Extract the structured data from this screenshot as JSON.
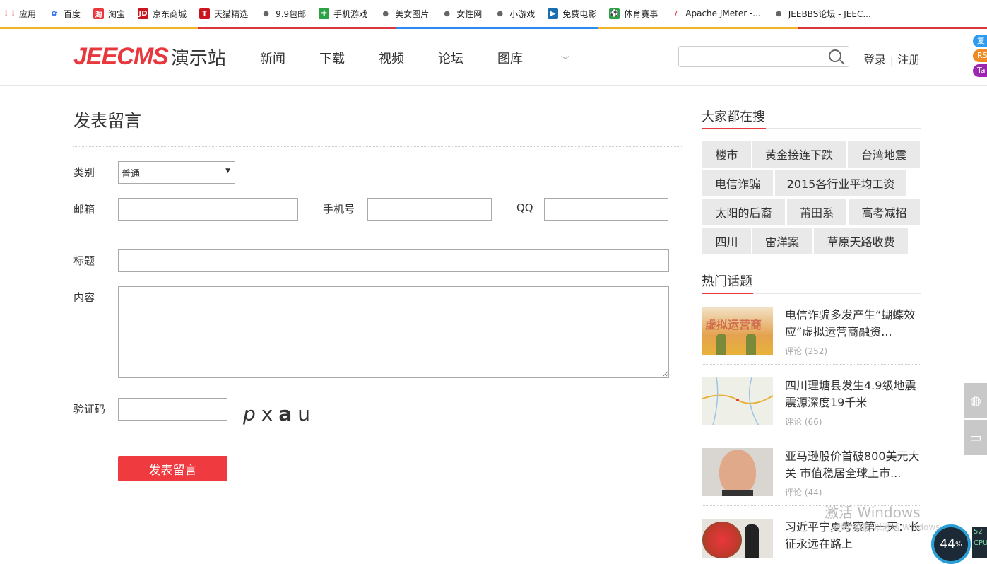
{
  "bookmarks": [
    {
      "label": "应用",
      "icon": "apps-grid-icon",
      "color": "#e8383d"
    },
    {
      "label": "百度",
      "icon": "baidu-paw-icon",
      "color": "#2d6df0"
    },
    {
      "label": "淘宝",
      "icon": "taobao-icon",
      "color": "#e8383d"
    },
    {
      "label": "京东商城",
      "icon": "jd-icon",
      "color": "#c9151e"
    },
    {
      "label": "天猫精选",
      "icon": "tmall-icon",
      "color": "#c9151e"
    },
    {
      "label": "9.9包邮",
      "icon": "globe-icon",
      "color": "#666666"
    },
    {
      "label": "手机游戏",
      "icon": "game-icon",
      "color": "#2ba245"
    },
    {
      "label": "美女图片",
      "icon": "globe-icon",
      "color": "#666666"
    },
    {
      "label": "女性网",
      "icon": "globe-icon",
      "color": "#666666"
    },
    {
      "label": "小游戏",
      "icon": "globe-icon",
      "color": "#666666"
    },
    {
      "label": "免费电影",
      "icon": "film-icon",
      "color": "#1a6fb0"
    },
    {
      "label": "体育赛事",
      "icon": "sports-icon",
      "color": "#2ba245"
    },
    {
      "label": "Apache JMeter -...",
      "icon": "feather-icon",
      "color": "#d9363e"
    },
    {
      "label": "JEEBBS论坛 - JEEC...",
      "icon": "globe-icon",
      "color": "#666666"
    }
  ],
  "header": {
    "logo_en": "JEECMS",
    "logo_cn": "演示站",
    "nav": [
      "新闻",
      "下载",
      "视频",
      "论坛",
      "图库"
    ],
    "search_placeholder": "",
    "login": "登录",
    "sep": "|",
    "register": "注册",
    "edge_buttons": [
      {
        "label": "复",
        "color": "#2d9cf0"
      },
      {
        "label": "RS",
        "color": "#f08a24"
      },
      {
        "label": "Ta",
        "color": "#9b27b0"
      }
    ]
  },
  "form": {
    "title": "发表留言",
    "category_label": "类别",
    "category_value": "普通",
    "email_label": "邮箱",
    "email_value": "",
    "phone_label": "手机号",
    "phone_value": "",
    "qq_label": "QQ",
    "qq_value": "",
    "subject_label": "标题",
    "subject_value": "",
    "content_label": "内容",
    "content_value": "",
    "captcha_label": "验证码",
    "captcha_value": "",
    "captcha_text": [
      "p",
      "x",
      "a",
      "u"
    ],
    "submit": "发表留言"
  },
  "sidebar": {
    "search_title": "大家都在搜",
    "tags": [
      "楼市",
      "黄金接连下跌",
      "台湾地震",
      "电信诈骗",
      "2015各行业平均工资",
      "太阳的后裔",
      "莆田系",
      "高考减招",
      "四川",
      "雷洋案",
      "草原天路收费"
    ],
    "hot_title": "热门话题",
    "news": [
      {
        "title": "电信诈骗多发产生“蝴蝶效应”虚拟运营商融资...",
        "comments": "评论 (252)",
        "thumb_text": "虚拟运营商"
      },
      {
        "title": "四川理塘县发生4.9级地震 震源深度19千米",
        "comments": "评论 (66)",
        "thumb_text": ""
      },
      {
        "title": "亚马逊股价首破800美元大关 市值稳居全球上市...",
        "comments": "评论 (44)",
        "thumb_text": ""
      },
      {
        "title": "习近平宁夏考察第一天：长征永远在路上",
        "comments": "",
        "thumb_text": ""
      }
    ]
  },
  "overlay": {
    "watermark": "激活 Windows",
    "watermark_sub": "转到\"设置\"以激活 Windows。",
    "gauge_value": "44",
    "gauge_unit": "%",
    "cpu_lines": [
      "52",
      "CPU"
    ]
  }
}
